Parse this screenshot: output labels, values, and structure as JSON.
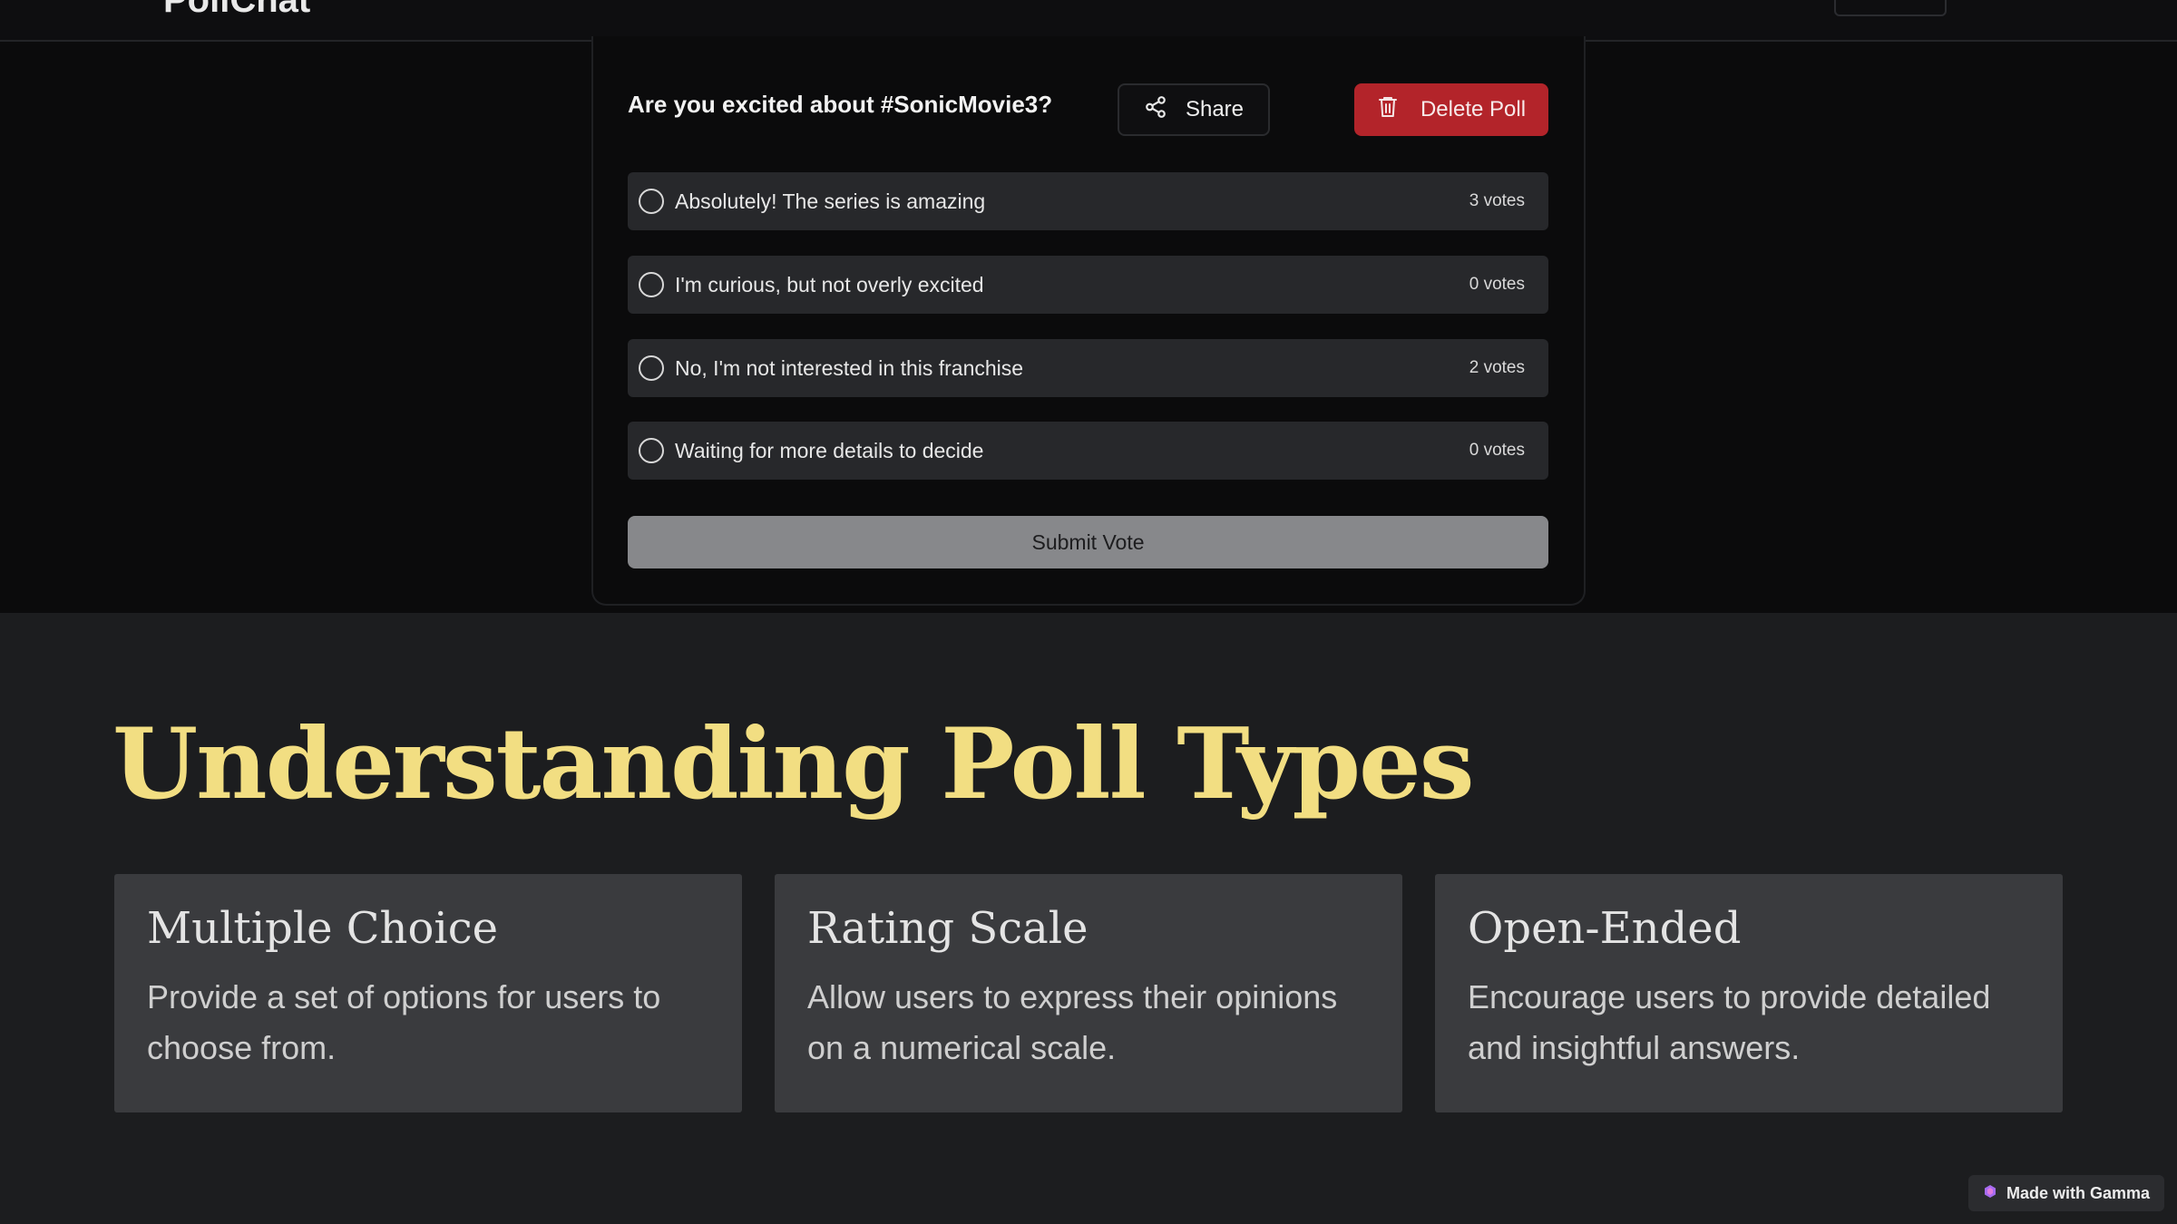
{
  "nav": {
    "logo": "PollChat"
  },
  "poll": {
    "question": "Are you excited about #SonicMovie3?",
    "share_label": "Share",
    "delete_label": "Delete Poll",
    "options": [
      {
        "label": "Absolutely! The series is amazing",
        "votes": "3 votes"
      },
      {
        "label": "I'm curious, but not overly excited",
        "votes": "0 votes"
      },
      {
        "label": "No, I'm not interested in this franchise",
        "votes": "2 votes"
      },
      {
        "label": "Waiting for more details to decide",
        "votes": "0 votes"
      }
    ],
    "submit_label": "Submit Vote"
  },
  "section": {
    "title": "Understanding Poll Types",
    "cards": [
      {
        "title": "Multiple Choice",
        "description": "Provide a set of options for users to choose from."
      },
      {
        "title": "Rating Scale",
        "description": "Allow users to express their opinions on a numerical scale."
      },
      {
        "title": "Open-Ended",
        "description": "Encourage users to provide detailed and insightful answers."
      }
    ]
  },
  "badge": {
    "label": "Made with Gamma"
  },
  "colors": {
    "accent_title": "#f2de82",
    "delete_red": "#b3242a",
    "card_bg": "#3a3b3e",
    "page_bg": "#1c1d1f"
  },
  "icons": {
    "share": "share-icon",
    "delete": "trash-icon",
    "badge": "gamma-logo-icon"
  }
}
